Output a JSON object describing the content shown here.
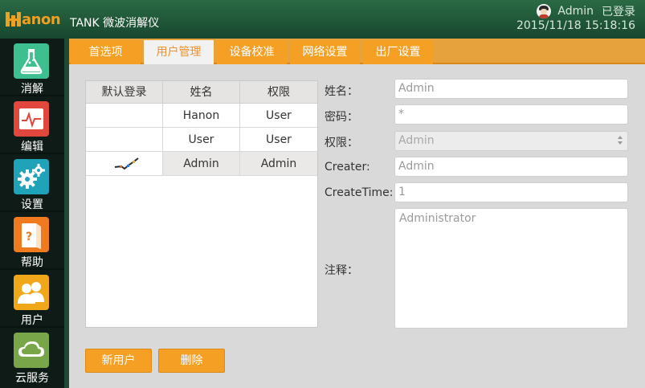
{
  "header": {
    "logo_text": "anon",
    "logo_full": "Hanon",
    "app_title": "TANK 微波消解仪",
    "user_name": "Admin",
    "login_status": "已登录",
    "datetime": "2015/11/18 15:18:16"
  },
  "sidebar": {
    "items": [
      {
        "label": "消解",
        "icon": "flask-icon",
        "color": "#3dbf8f"
      },
      {
        "label": "编辑",
        "icon": "chart-edit-icon",
        "color": "#e2473e"
      },
      {
        "label": "设置",
        "icon": "gears-icon",
        "color": "#1fa3b8"
      },
      {
        "label": "帮助",
        "icon": "help-book-icon",
        "color": "#f07a1e"
      },
      {
        "label": "用户",
        "icon": "users-icon",
        "color": "#f0a81a"
      },
      {
        "label": "云服务",
        "icon": "cloud-icon",
        "color": "#7aa64a"
      }
    ]
  },
  "tabs": [
    {
      "label": "首选项"
    },
    {
      "label": "用户管理"
    },
    {
      "label": "设备校准"
    },
    {
      "label": "网络设置"
    },
    {
      "label": "出厂设置"
    }
  ],
  "active_tab": "用户管理",
  "user_table": {
    "headers": [
      "默认登录",
      "姓名",
      "权限"
    ],
    "rows": [
      {
        "default": "",
        "name": "Hanon",
        "role": "User"
      },
      {
        "default": "",
        "name": "User",
        "role": "User"
      },
      {
        "default": "check",
        "name": "Admin",
        "role": "Admin"
      }
    ]
  },
  "form": {
    "name_label": "姓名：",
    "name_value": "Admin",
    "password_label": "密码：",
    "password_value": "*",
    "role_label": "权限：",
    "role_value": "Admin",
    "creater_label": "Creater:",
    "creater_value": "Admin",
    "createtime_label": "CreateTime:",
    "createtime_value": "1",
    "note_label": "注释：",
    "note_value": "Administrator"
  },
  "buttons": {
    "new_user": "新用户",
    "delete": "删除"
  },
  "colors": {
    "accent": "#f5a025",
    "header_green": "#1f5537",
    "sidebar_bg": "#0f1b16"
  }
}
